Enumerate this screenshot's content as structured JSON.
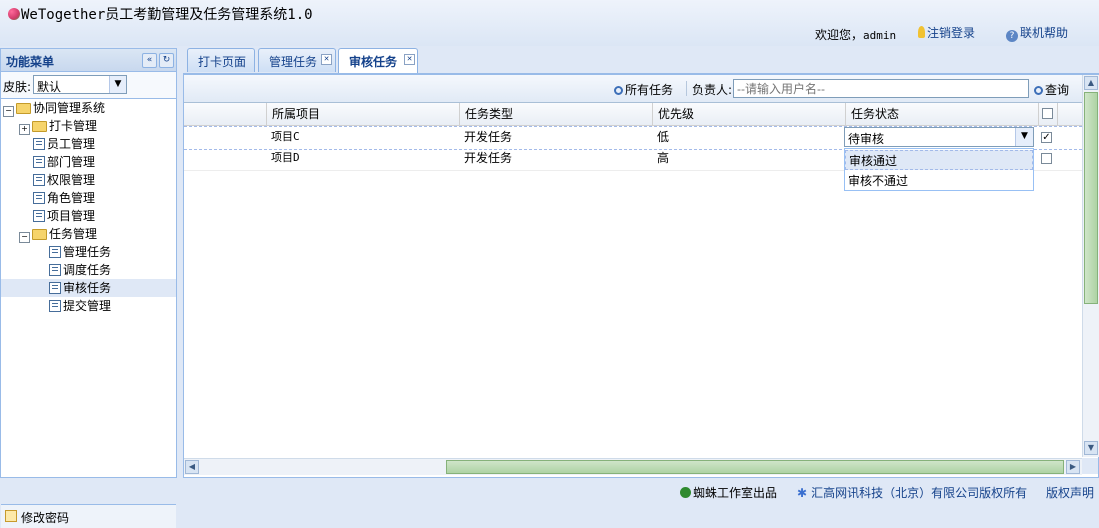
{
  "header": {
    "app_title": "WeTogether员工考勤管理及任务管理系统1.0",
    "welcome_prefix": "欢迎您，",
    "username": "admin",
    "logout_label": "注销登录",
    "help_label": "联机帮助"
  },
  "sidebar": {
    "title": "功能菜单",
    "skin_label": "皮肤:",
    "skin_value": "默认",
    "tree": [
      {
        "label": "协同管理系统"
      },
      {
        "label": "打卡管理"
      },
      {
        "label": "员工管理"
      },
      {
        "label": "部门管理"
      },
      {
        "label": "权限管理"
      },
      {
        "label": "角色管理"
      },
      {
        "label": "项目管理"
      },
      {
        "label": "任务管理"
      },
      {
        "label": "管理任务"
      },
      {
        "label": "调度任务"
      },
      {
        "label": "审核任务"
      },
      {
        "label": "提交管理"
      }
    ],
    "change_password": "修改密码"
  },
  "tabs": [
    {
      "label": "打卡页面"
    },
    {
      "label": "管理任务"
    },
    {
      "label": "审核任务"
    }
  ],
  "toolbar": {
    "all_tasks_label": "所有任务",
    "owner_label": "负责人:",
    "owner_placeholder": "--请输入用户名--",
    "query_label": "查询"
  },
  "grid": {
    "columns": [
      "所属项目",
      "任务类型",
      "优先级",
      "任务状态"
    ],
    "rows": [
      {
        "project": "项目C",
        "type": "开发任务",
        "priority": "低",
        "status": "待审核",
        "checked": true
      },
      {
        "project": "项目D",
        "type": "开发任务",
        "priority": "高",
        "status": "",
        "checked": false
      }
    ],
    "status_options": [
      "审核通过",
      "审核不通过"
    ]
  },
  "footer": {
    "studio": "蜘蛛工作室出品",
    "company": "汇高网讯科技（北京）有限公司版权所有",
    "copyright": "版权声明"
  },
  "colors": {
    "accent": "#15428b",
    "panel_border": "#99bbe8",
    "background": "#dfe8f6"
  }
}
